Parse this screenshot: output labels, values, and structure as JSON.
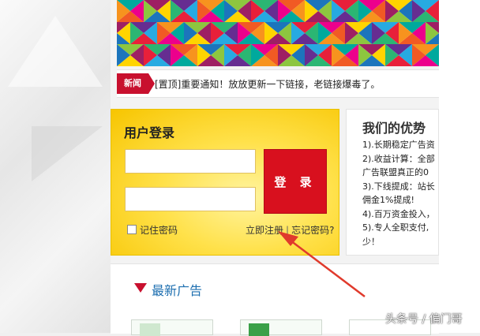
{
  "news": {
    "tag": "新闻",
    "text": "[置顶]重要通知！放放更新一下链接，老链接爆毒了。"
  },
  "login": {
    "title": "用户登录",
    "username_value": "",
    "password_value": "",
    "submit_label": "登 录",
    "remember_label": "记住密码",
    "register_link": "立即注册",
    "separator": "|",
    "forgot_link": "忘记密码?"
  },
  "advantages": {
    "title": "我们的优势",
    "lines": [
      "1).长期稳定广告资",
      "2).收益计算：全部",
      "广告联盟真正的0",
      "3).下线提成：站长",
      "佣金1%提成!",
      "4).百万资金投入，",
      "5).专人全职支付,",
      "少！"
    ]
  },
  "latest": {
    "title": "最新广告"
  },
  "watermark": "头条号 / 偏门哥",
  "colors": {
    "accent_red": "#c8102e",
    "login_button": "#d8101e",
    "login_panel": "#ffe14a",
    "title_blue": "#1e6fb0",
    "annotation_arrow": "#e03a2c"
  }
}
